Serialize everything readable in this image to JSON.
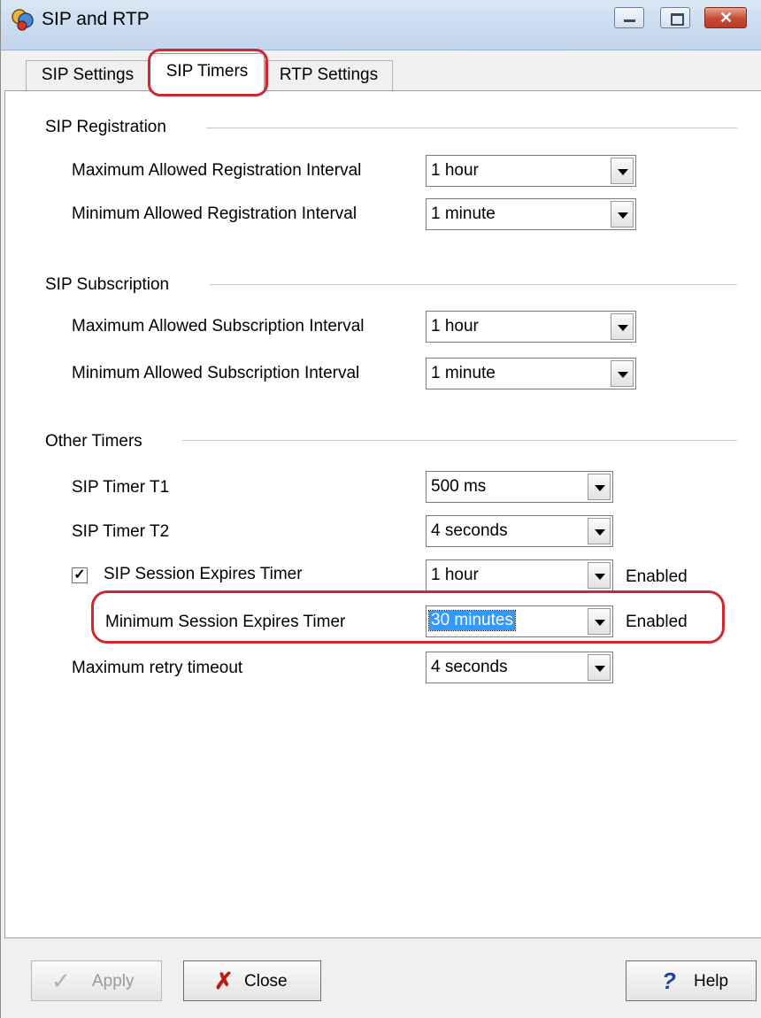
{
  "window": {
    "title": "SIP and RTP"
  },
  "tabs": [
    {
      "label": "SIP Settings",
      "active": false
    },
    {
      "label": "SIP Timers",
      "active": true
    },
    {
      "label": "RTP Settings",
      "active": false
    }
  ],
  "registration": {
    "title": "SIP Registration",
    "max_label": "Maximum Allowed Registration Interval",
    "max_value": "1 hour",
    "min_label": "Minimum Allowed Registration Interval",
    "min_value": "1 minute"
  },
  "subscription": {
    "title": "SIP Subscription",
    "max_label": "Maximum Allowed Subscription Interval",
    "max_value": "1 hour",
    "min_label": "Minimum Allowed Subscription Interval",
    "min_value": "1 minute"
  },
  "other": {
    "title": "Other Timers",
    "t1_label": "SIP Timer T1",
    "t1_value": "500 ms",
    "t2_label": "SIP Timer T2",
    "t2_value": "4 seconds",
    "session_label": "SIP Session Expires Timer",
    "session_checked": true,
    "session_value": "1 hour",
    "session_status": "Enabled",
    "min_session_label": "Minimum Session Expires Timer",
    "min_session_value": "30 minutes",
    "min_session_status": "Enabled",
    "retry_label": "Maximum retry timeout",
    "retry_value": "4 seconds"
  },
  "buttons": {
    "apply": "Apply",
    "close": "Close",
    "help": "Help"
  },
  "colors": {
    "highlight": "#d4262f",
    "selection": "#3399ff"
  }
}
